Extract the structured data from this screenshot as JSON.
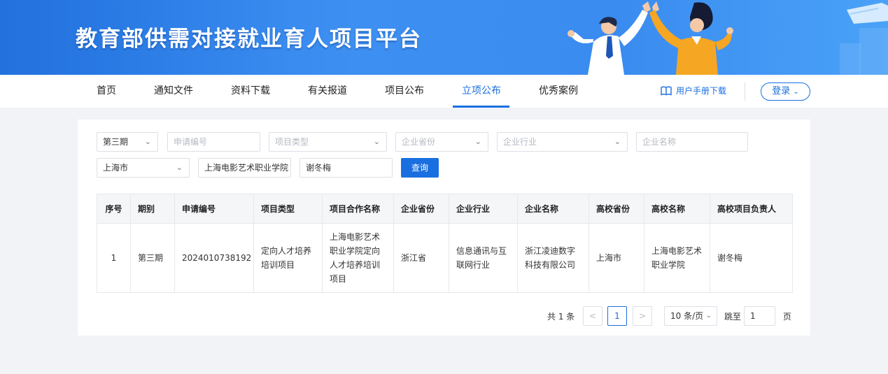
{
  "banner": {
    "title": "教育部供需对接就业育人项目平台"
  },
  "nav": {
    "items": [
      {
        "label": "首页"
      },
      {
        "label": "通知文件"
      },
      {
        "label": "资料下载"
      },
      {
        "label": "有关报道"
      },
      {
        "label": "项目公布"
      },
      {
        "label": "立项公布"
      },
      {
        "label": "优秀案例"
      }
    ],
    "active_index": 5,
    "manual_label": "用户手册下载",
    "login_label": "登录"
  },
  "filters": {
    "period": "第三期",
    "app_no_placeholder": "申请编号",
    "project_type_placeholder": "项目类型",
    "company_province_placeholder": "企业省份",
    "company_industry_placeholder": "企业行业",
    "company_name_placeholder": "企业名称",
    "school_province": "上海市",
    "school_name": "上海电影艺术职业学院",
    "leader": "谢冬梅",
    "search_label": "查询"
  },
  "table": {
    "headers": [
      "序号",
      "期别",
      "申请编号",
      "项目类型",
      "项目合作名称",
      "企业省份",
      "企业行业",
      "企业名称",
      "高校省份",
      "高校名称",
      "高校项目负责人"
    ],
    "rows": [
      [
        "1",
        "第三期",
        "2024010738192",
        "定向人才培养培训项目",
        "上海电影艺术职业学院定向人才培养培训项目",
        "浙江省",
        "信息通讯与互联网行业",
        "浙江凌迪数字科技有限公司",
        "上海市",
        "上海电影艺术职业学院",
        "谢冬梅"
      ]
    ]
  },
  "pagination": {
    "total_label": "共 1 条",
    "prev": "<",
    "current_page": "1",
    "next": ">",
    "page_size": "10 条/页",
    "jump_label": "跳至",
    "jump_value": "1",
    "page_unit": "页"
  },
  "colors": {
    "primary": "#1a6fe0",
    "banner": "#3a8cf0"
  }
}
